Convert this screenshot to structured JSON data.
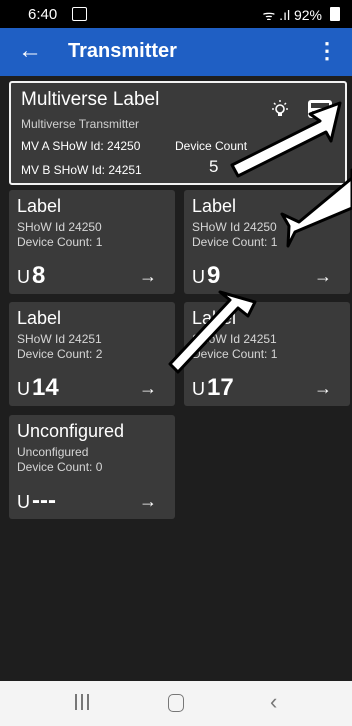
{
  "status": {
    "time": "6:40",
    "right": "ᯤ .ıl 92%"
  },
  "appbar": {
    "title": "Transmitter",
    "back_icon": "←",
    "menu_icon": "⋮"
  },
  "multiverse": {
    "name": "Multiverse Label",
    "subtitle": "Multiverse Transmitter",
    "mv_a": "MV A SHoW Id: 24250",
    "mv_b": "MV B SHoW Id: 24251",
    "device_count_label": "Device Count",
    "device_count": "5"
  },
  "cards": [
    {
      "label": "Label",
      "show": "SHoW Id 24250",
      "devices": "Device Count: 1",
      "u_prefix": "U",
      "u_value": "8",
      "arrow": "→"
    },
    {
      "label": "Label",
      "show": "SHoW Id 24250",
      "devices": "Device Count: 1",
      "u_prefix": "U",
      "u_value": "9",
      "arrow": "→"
    },
    {
      "label": "Label",
      "show": "SHoW Id 24251",
      "devices": "Device Count: 2",
      "u_prefix": "U",
      "u_value": "14",
      "arrow": "→"
    },
    {
      "label": "Label",
      "show": "SHoW Id 24251",
      "devices": "Device Count: 1",
      "u_prefix": "U",
      "u_value": "17",
      "arrow": "→"
    },
    {
      "label": "Unconfigured",
      "show": "Unconfigured",
      "devices": "Device Count: 0",
      "u_prefix": "U",
      "u_value": "---",
      "arrow": "→"
    }
  ],
  "navbar": {
    "back": "‹"
  }
}
